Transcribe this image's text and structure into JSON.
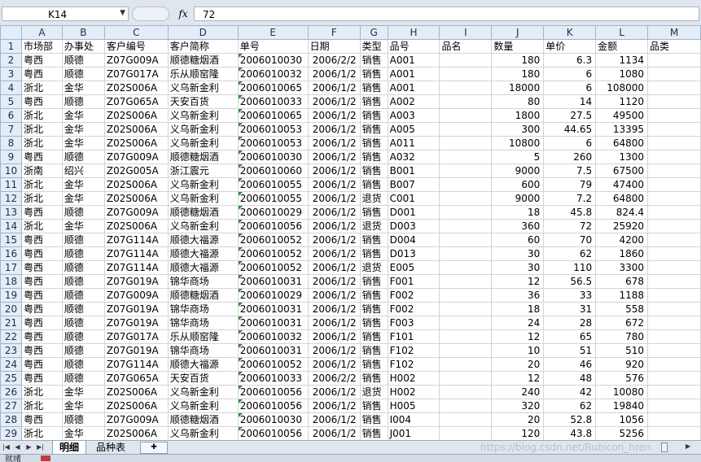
{
  "formula_bar": {
    "cell_ref": "K14",
    "fx_label": "fx",
    "content": "72"
  },
  "columns": [
    "A",
    "B",
    "C",
    "D",
    "E",
    "F",
    "G",
    "H",
    "I",
    "J",
    "K",
    "L",
    "M"
  ],
  "rows": [
    [
      "市场部",
      "办事处",
      "客户编号",
      "客户简称",
      "单号",
      "日期",
      "类型",
      "品号",
      "品名",
      "数量",
      "单价",
      "金额",
      "品类"
    ],
    [
      "粤西",
      "顺德",
      "Z07G009A",
      "顺德糖烟酒",
      "2006010030",
      "2006/2/2",
      "销售",
      "A001",
      "",
      "180",
      "6.3",
      "1134",
      ""
    ],
    [
      "粤西",
      "顺德",
      "Z07G017A",
      "乐从顺窑隆",
      "2006010032",
      "2006/1/2",
      "销售",
      "A001",
      "",
      "180",
      "6",
      "1080",
      ""
    ],
    [
      "浙北",
      "金华",
      "Z02S006A",
      "义乌新金利",
      "2006010065",
      "2006/1/2",
      "销售",
      "A001",
      "",
      "18000",
      "6",
      "108000",
      ""
    ],
    [
      "粤西",
      "顺德",
      "Z07G065A",
      "天安百货",
      "2006010033",
      "2006/1/2",
      "销售",
      "A002",
      "",
      "80",
      "14",
      "1120",
      ""
    ],
    [
      "浙北",
      "金华",
      "Z02S006A",
      "义乌新金利",
      "2006010065",
      "2006/1/2",
      "销售",
      "A003",
      "",
      "1800",
      "27.5",
      "49500",
      ""
    ],
    [
      "浙北",
      "金华",
      "Z02S006A",
      "义乌新金利",
      "2006010053",
      "2006/1/2",
      "销售",
      "A005",
      "",
      "300",
      "44.65",
      "13395",
      ""
    ],
    [
      "浙北",
      "金华",
      "Z02S006A",
      "义乌新金利",
      "2006010053",
      "2006/1/2",
      "销售",
      "A011",
      "",
      "10800",
      "6",
      "64800",
      ""
    ],
    [
      "粤西",
      "顺德",
      "Z07G009A",
      "顺德糖烟酒",
      "2006010030",
      "2006/1/2",
      "销售",
      "A032",
      "",
      "5",
      "260",
      "1300",
      ""
    ],
    [
      "浙南",
      "绍兴",
      "Z02G005A",
      "浙江震元",
      "2006010060",
      "2006/1/2",
      "销售",
      "B001",
      "",
      "9000",
      "7.5",
      "67500",
      ""
    ],
    [
      "浙北",
      "金华",
      "Z02S006A",
      "义乌新金利",
      "2006010055",
      "2006/1/2",
      "销售",
      "B007",
      "",
      "600",
      "79",
      "47400",
      ""
    ],
    [
      "浙北",
      "金华",
      "Z02S006A",
      "义乌新金利",
      "2006010055",
      "2006/1/2",
      "退货",
      "C001",
      "",
      "9000",
      "7.2",
      "64800",
      ""
    ],
    [
      "粤西",
      "顺德",
      "Z07G009A",
      "顺德糖烟酒",
      "2006010029",
      "2006/1/2",
      "销售",
      "D001",
      "",
      "18",
      "45.8",
      "824.4",
      ""
    ],
    [
      "浙北",
      "金华",
      "Z02S006A",
      "义乌新金利",
      "2006010056",
      "2006/1/2",
      "退货",
      "D003",
      "",
      "360",
      "72",
      "25920",
      ""
    ],
    [
      "粤西",
      "顺德",
      "Z07G114A",
      "顺德大福源",
      "2006010052",
      "2006/1/2",
      "销售",
      "D004",
      "",
      "60",
      "70",
      "4200",
      ""
    ],
    [
      "粤西",
      "顺德",
      "Z07G114A",
      "顺德大福源",
      "2006010052",
      "2006/1/2",
      "销售",
      "D013",
      "",
      "30",
      "62",
      "1860",
      ""
    ],
    [
      "粤西",
      "顺德",
      "Z07G114A",
      "顺德大福源",
      "2006010052",
      "2006/1/2",
      "退货",
      "E005",
      "",
      "30",
      "110",
      "3300",
      ""
    ],
    [
      "粤西",
      "顺德",
      "Z07G019A",
      "锦华商场",
      "2006010031",
      "2006/1/2",
      "销售",
      "F001",
      "",
      "12",
      "56.5",
      "678",
      ""
    ],
    [
      "粤西",
      "顺德",
      "Z07G009A",
      "顺德糖烟酒",
      "2006010029",
      "2006/1/2",
      "销售",
      "F002",
      "",
      "36",
      "33",
      "1188",
      ""
    ],
    [
      "粤西",
      "顺德",
      "Z07G019A",
      "锦华商场",
      "2006010031",
      "2006/1/2",
      "销售",
      "F002",
      "",
      "18",
      "31",
      "558",
      ""
    ],
    [
      "粤西",
      "顺德",
      "Z07G019A",
      "锦华商场",
      "2006010031",
      "2006/1/2",
      "销售",
      "F003",
      "",
      "24",
      "28",
      "672",
      ""
    ],
    [
      "粤西",
      "顺德",
      "Z07G017A",
      "乐从顺窑隆",
      "2006010032",
      "2006/1/2",
      "销售",
      "F101",
      "",
      "12",
      "65",
      "780",
      ""
    ],
    [
      "粤西",
      "顺德",
      "Z07G019A",
      "锦华商场",
      "2006010031",
      "2006/1/2",
      "销售",
      "F102",
      "",
      "10",
      "51",
      "510",
      ""
    ],
    [
      "粤西",
      "顺德",
      "Z07G114A",
      "顺德大福源",
      "2006010052",
      "2006/1/2",
      "销售",
      "F102",
      "",
      "20",
      "46",
      "920",
      ""
    ],
    [
      "粤西",
      "顺德",
      "Z07G065A",
      "天安百货",
      "2006010033",
      "2006/2/2",
      "销售",
      "H002",
      "",
      "12",
      "48",
      "576",
      ""
    ],
    [
      "浙北",
      "金华",
      "Z02S006A",
      "义乌新金利",
      "2006010056",
      "2006/1/2",
      "退货",
      "H002",
      "",
      "240",
      "42",
      "10080",
      ""
    ],
    [
      "浙北",
      "金华",
      "Z02S006A",
      "义乌新金利",
      "2006010056",
      "2006/1/2",
      "销售",
      "H005",
      "",
      "320",
      "62",
      "19840",
      ""
    ],
    [
      "粤西",
      "顺德",
      "Z07G009A",
      "顺德糖烟酒",
      "2006010030",
      "2006/1/2",
      "销售",
      "I004",
      "",
      "20",
      "52.8",
      "1056",
      ""
    ],
    [
      "浙北",
      "金华",
      "Z02S006A",
      "义乌新金利",
      "2006010056",
      "2006/1/2",
      "销售",
      "J001",
      "",
      "120",
      "43.8",
      "5256",
      ""
    ]
  ],
  "sheet_tabs": [
    "明细",
    "品种表"
  ],
  "watermark": "https://blog.csdn.net/Rubicon_hren",
  "status": {
    "ready": "就绪"
  },
  "colors": {
    "header_bg": "#e4ecf7",
    "grid_line": "#d4d4d4",
    "triangle": "#2c8a2c"
  }
}
